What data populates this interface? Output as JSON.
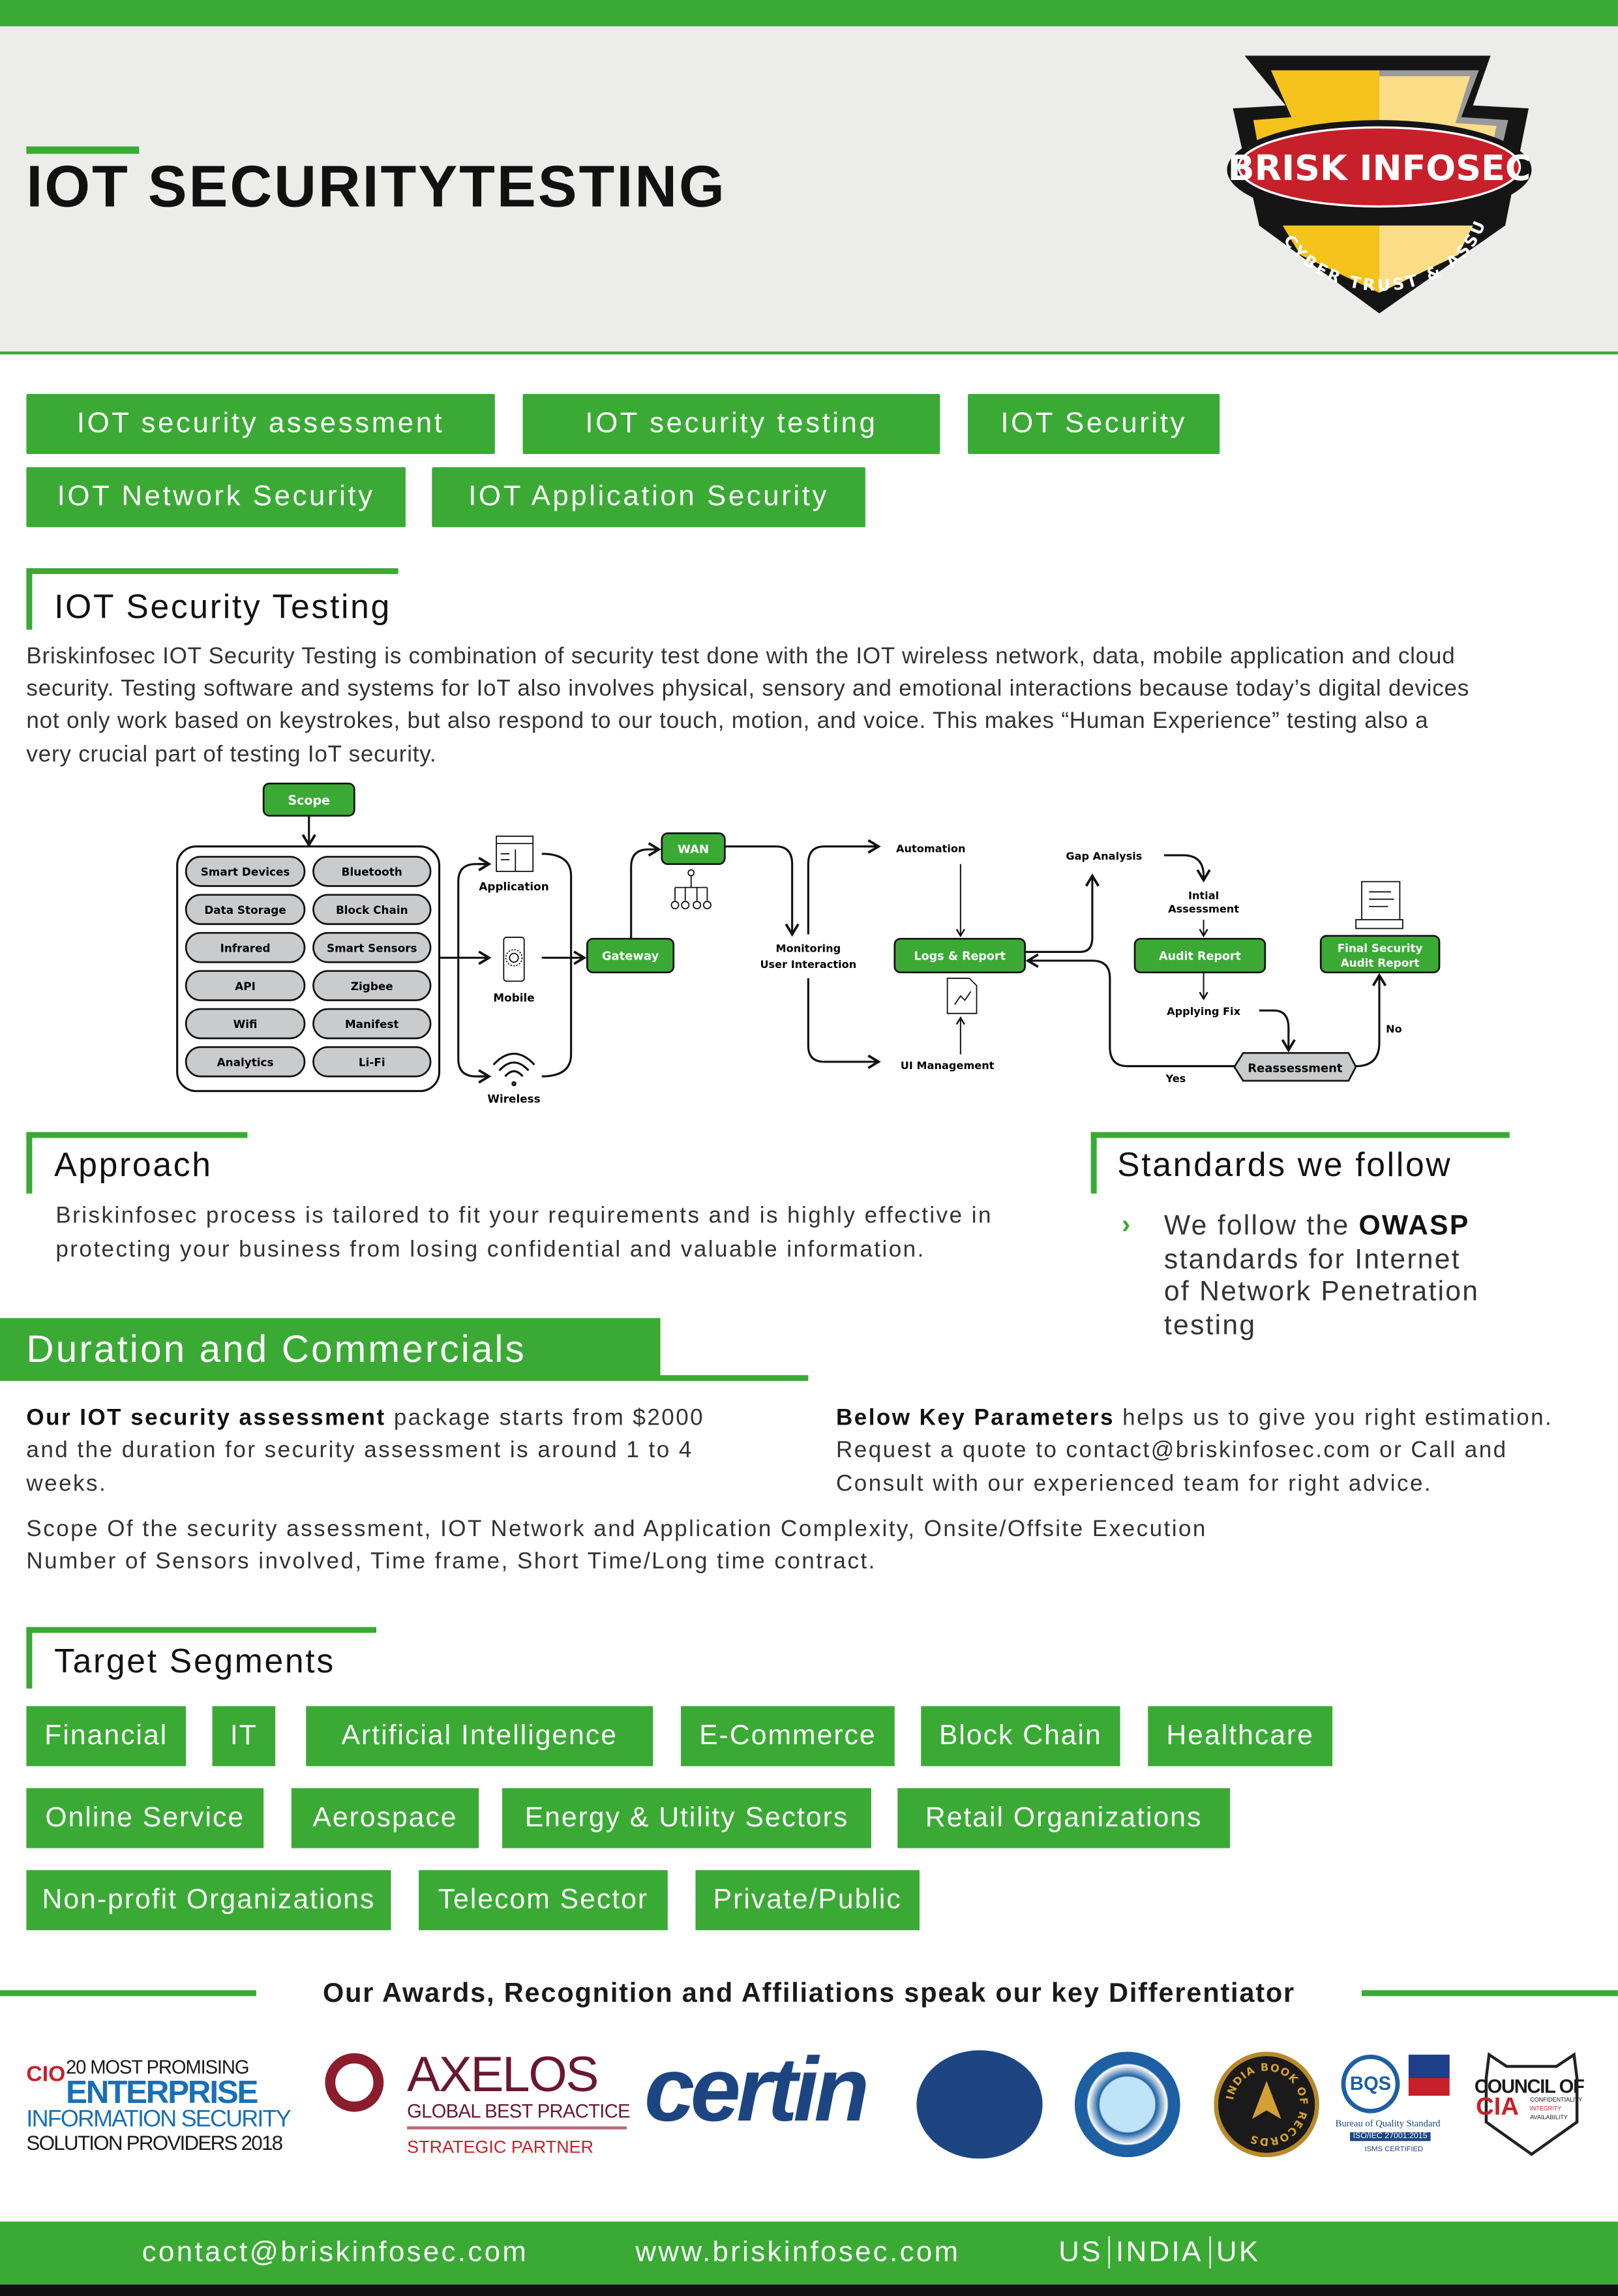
{
  "header": {
    "title": "IOT SECURITYTESTING",
    "logo": {
      "name": "BRISK INFOSEC",
      "tagline": "CYBER TRUST & ASSURANCE"
    }
  },
  "tags": [
    "IOT security assessment",
    "IOT security testing",
    "IOT Security",
    "IOT Network Security",
    "IOT Application Security"
  ],
  "intro": {
    "title": "IOT Security Testing",
    "lines": [
      "Briskinfosec IOT Security Testing is combination of security test done with the IOT wireless network, data, mobile application and cloud",
      "security. Testing software and systems for IoT also involves physical, sensory and emotional interactions because today’s digital devices",
      "not only work based on keystrokes, but also respond to our touch, motion, and voice. This makes “Human Experience” testing also a",
      "very crucial part of testing IoT security."
    ]
  },
  "diagram": {
    "scope": "Scope",
    "scope_items": [
      "Smart Devices",
      "Bluetooth",
      "Data Storage",
      "Block Chain",
      "Infrared",
      "Smart Sensors",
      "API",
      "Zigbee",
      "Wifi",
      "Manifest",
      "Analytics",
      "Li-Fi"
    ],
    "channels": [
      "Application",
      "Mobile",
      "Wireless"
    ],
    "gateway": "Gateway",
    "wan": "WAN",
    "monitoring": [
      "Monitoring",
      "User Interaction"
    ],
    "automation": "Automation",
    "ui_management": "UI Management",
    "logs": "Logs & Report",
    "gap": "Gap Analysis",
    "initial": [
      "Intial",
      "Assessment"
    ],
    "audit": "Audit Report",
    "applying": "Applying Fix",
    "reassessment": "Reassessment",
    "yes": "Yes",
    "no": "No",
    "final": [
      "Final Security",
      "Audit Report"
    ]
  },
  "approach": {
    "title": "Approach",
    "lines": [
      "Briskinfosec process is tailored to fit your requirements and is highly effective in",
      "protecting your business from losing confidential and valuable information."
    ]
  },
  "standards": {
    "title": "Standards we follow",
    "lead": "We follow the ",
    "bold": "OWASP",
    "lines": [
      "standards for Internet",
      "of Network Penetration",
      "testing"
    ]
  },
  "duration": {
    "title": "Duration and Commercials",
    "left_bold": "Our IOT security assessment",
    "left_lines": [
      " package starts from $2000",
      "and the duration for security assessment is around 1 to 4",
      "weeks."
    ],
    "right_bold": "Below Key Parameters",
    "right_lines": [
      " helps us to give you right estimation.",
      "Request a quote to contact@briskinfosec.com or Call and",
      "Consult with our experienced team for right advice."
    ],
    "scope_lines": [
      "Scope Of the security assessment, IOT Network and Application Complexity, Onsite/Offsite Execution",
      "Number of Sensors involved, Time frame, Short Time/Long time contract."
    ]
  },
  "segments": {
    "title": "Target Segments",
    "items": [
      "Financial",
      "IT",
      "Artificial Intelligence",
      "E-Commerce",
      "Block Chain",
      "Healthcare",
      "Online Service",
      "Aerospace",
      "Energy & Utility Sectors",
      "Retail Organizations",
      "Non-profit Organizations",
      "Telecom Sector",
      "Private/Public"
    ]
  },
  "awards": {
    "title": "Our Awards, Recognition and Affiliations speak our key Differentiator",
    "cio": [
      "20 MOST PROMISING",
      "ENTERPRISE",
      "INFORMATION SECURITY",
      "SOLUTION PROVIDERS 2018"
    ],
    "axelos": [
      "AXELOS",
      "GLOBAL BEST PRACTICE",
      "STRATEGIC PARTNER"
    ],
    "certin": "certin",
    "bqs": [
      "BQS",
      "Bureau of Quality Standard",
      "ISO/IEC 27001:2015",
      "ISMS CERTIFIED"
    ],
    "india_book": "INDIA BOOK OF RECORDS",
    "cia": [
      "COUNCIL OF",
      "CIA",
      "CONFIDENTIALITY",
      "INTEGRITY",
      "AVAILABILITY"
    ]
  },
  "footer": {
    "email": "contact@briskinfosec.com",
    "website": "www.briskinfosec.com",
    "regions": [
      "US",
      "INDIA",
      "UK"
    ]
  },
  "colors": {
    "accent": "#3aaa35",
    "header_bg": "#ececea",
    "pill_gray": "#c9cbcc",
    "logo_red": "#c8202a",
    "logo_yellow": "#f6c21c"
  }
}
